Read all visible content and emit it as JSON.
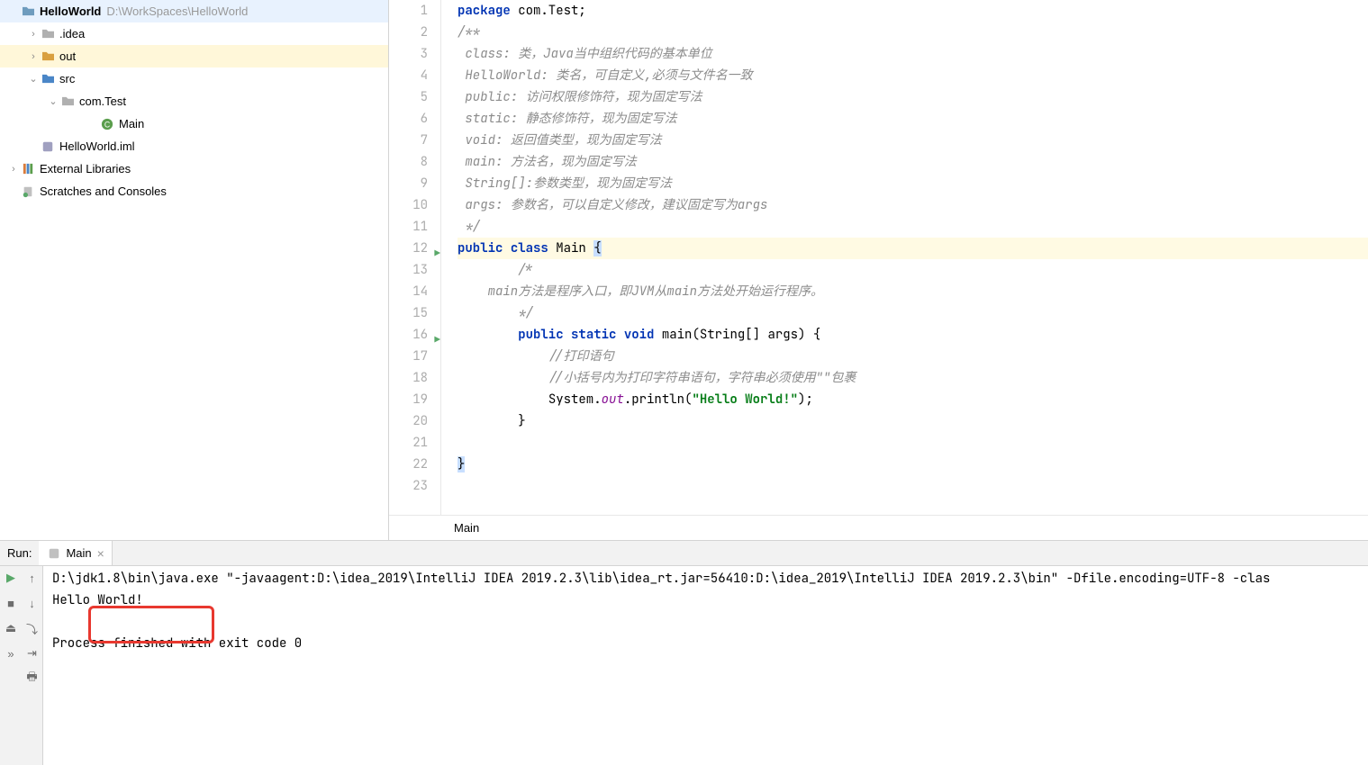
{
  "project_tree": {
    "root_name": "HelloWorld",
    "root_path": "D:\\WorkSpaces\\HelloWorld",
    "idea": ".idea",
    "out": "out",
    "src": "src",
    "pkg": "com.Test",
    "main_class": "Main",
    "iml": "HelloWorld.iml",
    "ext_lib": "External Libraries",
    "scratches": "Scratches and Consoles"
  },
  "code": {
    "lines": [
      {
        "n": 1,
        "type": "code",
        "segments": [
          {
            "t": "package ",
            "c": "kw"
          },
          {
            "t": "com.Test;",
            "c": "ident"
          }
        ]
      },
      {
        "n": 2,
        "type": "comment",
        "text": "/**"
      },
      {
        "n": 3,
        "type": "comment",
        "text": " class: 类，Java当中组织代码的基本单位"
      },
      {
        "n": 4,
        "type": "comment",
        "text": " HelloWorld: 类名，可自定义,必须与文件名一致"
      },
      {
        "n": 5,
        "type": "comment",
        "text": " public: 访问权限修饰符，现为固定写法"
      },
      {
        "n": 6,
        "type": "comment",
        "text": " static: 静态修饰符，现为固定写法"
      },
      {
        "n": 7,
        "type": "comment",
        "text": " void: 返回值类型，现为固定写法"
      },
      {
        "n": 8,
        "type": "comment",
        "text": " main: 方法名，现为固定写法"
      },
      {
        "n": 9,
        "type": "comment",
        "text": " String[]:参数类型，现为固定写法"
      },
      {
        "n": 10,
        "type": "comment",
        "text": " args: 参数名，可以自定义修改，建议固定写为args"
      },
      {
        "n": 11,
        "type": "comment",
        "text": " */"
      },
      {
        "n": 12,
        "type": "class",
        "hl": true,
        "run": true
      },
      {
        "n": 13,
        "type": "comment",
        "indent": "        ",
        "text": "/*"
      },
      {
        "n": 14,
        "type": "comment",
        "indent": "    ",
        "text": "main方法是程序入口，即JVM从main方法处开始运行程序。"
      },
      {
        "n": 15,
        "type": "comment",
        "indent": "        ",
        "text": "*/"
      },
      {
        "n": 16,
        "type": "main",
        "run": true
      },
      {
        "n": 17,
        "type": "comment",
        "indent": "            ",
        "text": "//打印语句"
      },
      {
        "n": 18,
        "type": "comment",
        "indent": "            ",
        "text": "//小括号内为打印字符串语句，字符串必须使用\"\"包裹"
      },
      {
        "n": 19,
        "type": "println"
      },
      {
        "n": 20,
        "type": "plain",
        "text": "        }"
      },
      {
        "n": 21,
        "type": "plain",
        "text": ""
      },
      {
        "n": 22,
        "type": "closebrace"
      },
      {
        "n": 23,
        "type": "plain",
        "text": ""
      }
    ],
    "class_kw_public": "public",
    "class_kw_class": "class",
    "class_name": "Main",
    "main_sig_public": "public",
    "main_sig_static": "static",
    "main_sig_void": "void",
    "main_sig_rest": "main(String[] args) {",
    "println_pre": "System.",
    "println_out": "out",
    "println_mid": ".println(",
    "println_str": "\"Hello World!\"",
    "println_post": ");"
  },
  "breadcrumb": "Main",
  "run": {
    "panel_label": "Run:",
    "tab_name": "Main",
    "cmd_line": "D:\\jdk1.8\\bin\\java.exe \"-javaagent:D:\\idea_2019\\IntelliJ IDEA 2019.2.3\\lib\\idea_rt.jar=56410:D:\\idea_2019\\IntelliJ IDEA 2019.2.3\\bin\" -Dfile.encoding=UTF-8 -clas",
    "output": "Hello World!",
    "exit": "Process finished with exit code 0"
  }
}
